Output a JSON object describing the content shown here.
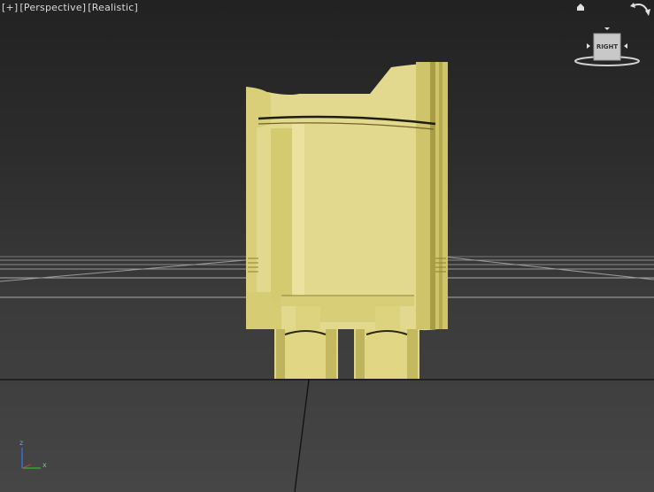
{
  "viewport_label": {
    "plus_menu": "[+]",
    "view_mode": "[Perspective]",
    "shading_mode": "[Realistic]"
  },
  "viewcube": {
    "face_label": "RIGHT"
  },
  "axis_tripod": {
    "z": "z",
    "x": "x"
  },
  "colors": {
    "model_main": "#e3d98e",
    "model_shadow": "#b8ac52",
    "grid_line": "#8a8a8a",
    "background_top": "#222222",
    "background_bottom": "#464646"
  }
}
